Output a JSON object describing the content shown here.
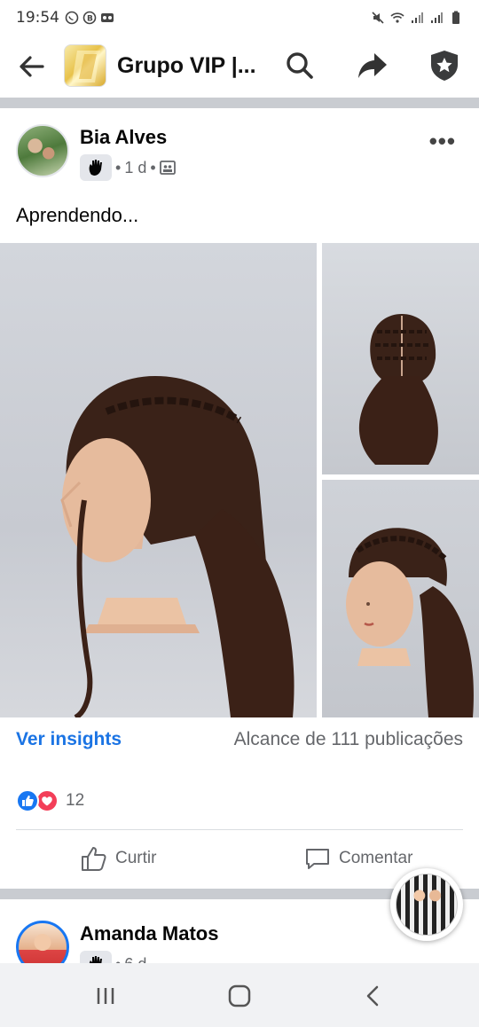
{
  "status_bar": {
    "time": "19:54",
    "left_icons": [
      "whatsapp-icon",
      "b-icon",
      "voicemail-icon"
    ],
    "right_icons": [
      "mute-icon",
      "wifi-icon",
      "signal-icon",
      "signal-icon",
      "battery-icon"
    ]
  },
  "app_bar": {
    "title": "Grupo VIP |...",
    "icons": [
      "back-arrow-icon",
      "search-icon",
      "share-icon",
      "admin-shield-icon"
    ]
  },
  "post": {
    "author": "Bia Alves",
    "time": "1 d",
    "separator": "•",
    "text": "Aprendendo...",
    "photos": 3,
    "insights_label": "Ver insights",
    "reach_label": "Alcance de 111 publicações",
    "reactions": {
      "types": [
        "like",
        "love"
      ],
      "count": "12"
    },
    "actions": {
      "like": "Curtir",
      "comment": "Comentar"
    }
  },
  "next_post": {
    "author": "Amanda Matos",
    "time": "6 d"
  },
  "colors": {
    "accent": "#1b74e4",
    "like": "#1877f2",
    "love": "#f33e58",
    "divider": "#c9ccd1",
    "secondary_text": "#65676b"
  },
  "nav_bar": {
    "buttons": [
      "recents-icon",
      "home-icon",
      "back-nav-icon"
    ]
  }
}
